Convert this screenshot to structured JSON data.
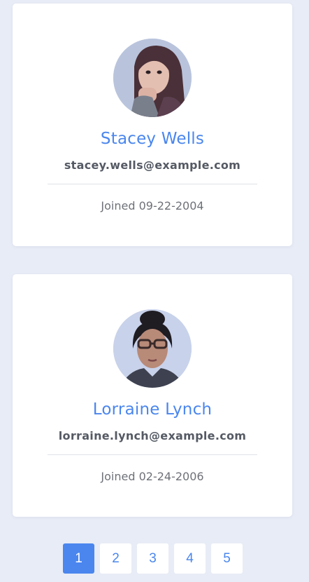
{
  "users": [
    {
      "name": "Stacey Wells",
      "email": "stacey.wells@example.com",
      "joined": "Joined 09-22-2004"
    },
    {
      "name": "Lorraine Lynch",
      "email": "lorraine.lynch@example.com",
      "joined": "Joined 02-24-2006"
    }
  ],
  "pagination": {
    "pages": [
      "1",
      "2",
      "3",
      "4",
      "5"
    ],
    "active_page": "1"
  },
  "colors": {
    "accent": "#4a86ee",
    "background": "#e8ecf6",
    "card": "#ffffff",
    "email_text": "#555a64",
    "joined_text": "#6e7178"
  }
}
